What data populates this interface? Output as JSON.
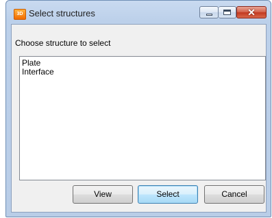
{
  "window": {
    "title": "Select structures",
    "app_icon": "app-logo-icon",
    "controls": {
      "minimize": "minimize-icon",
      "maximize": "maximize-icon",
      "close": "close-icon",
      "close_glyph": "✕"
    }
  },
  "dialog": {
    "prompt": "Choose structure to select",
    "structures": [
      "Plate",
      "Interface"
    ],
    "buttons": {
      "view": "View",
      "select": "Select",
      "cancel": "Cancel"
    }
  },
  "colors": {
    "titlebar": "#bcd0ea",
    "client_background": "#f0f0f0",
    "close_button": "#c2381f",
    "default_button_border": "#3c7fb1"
  }
}
